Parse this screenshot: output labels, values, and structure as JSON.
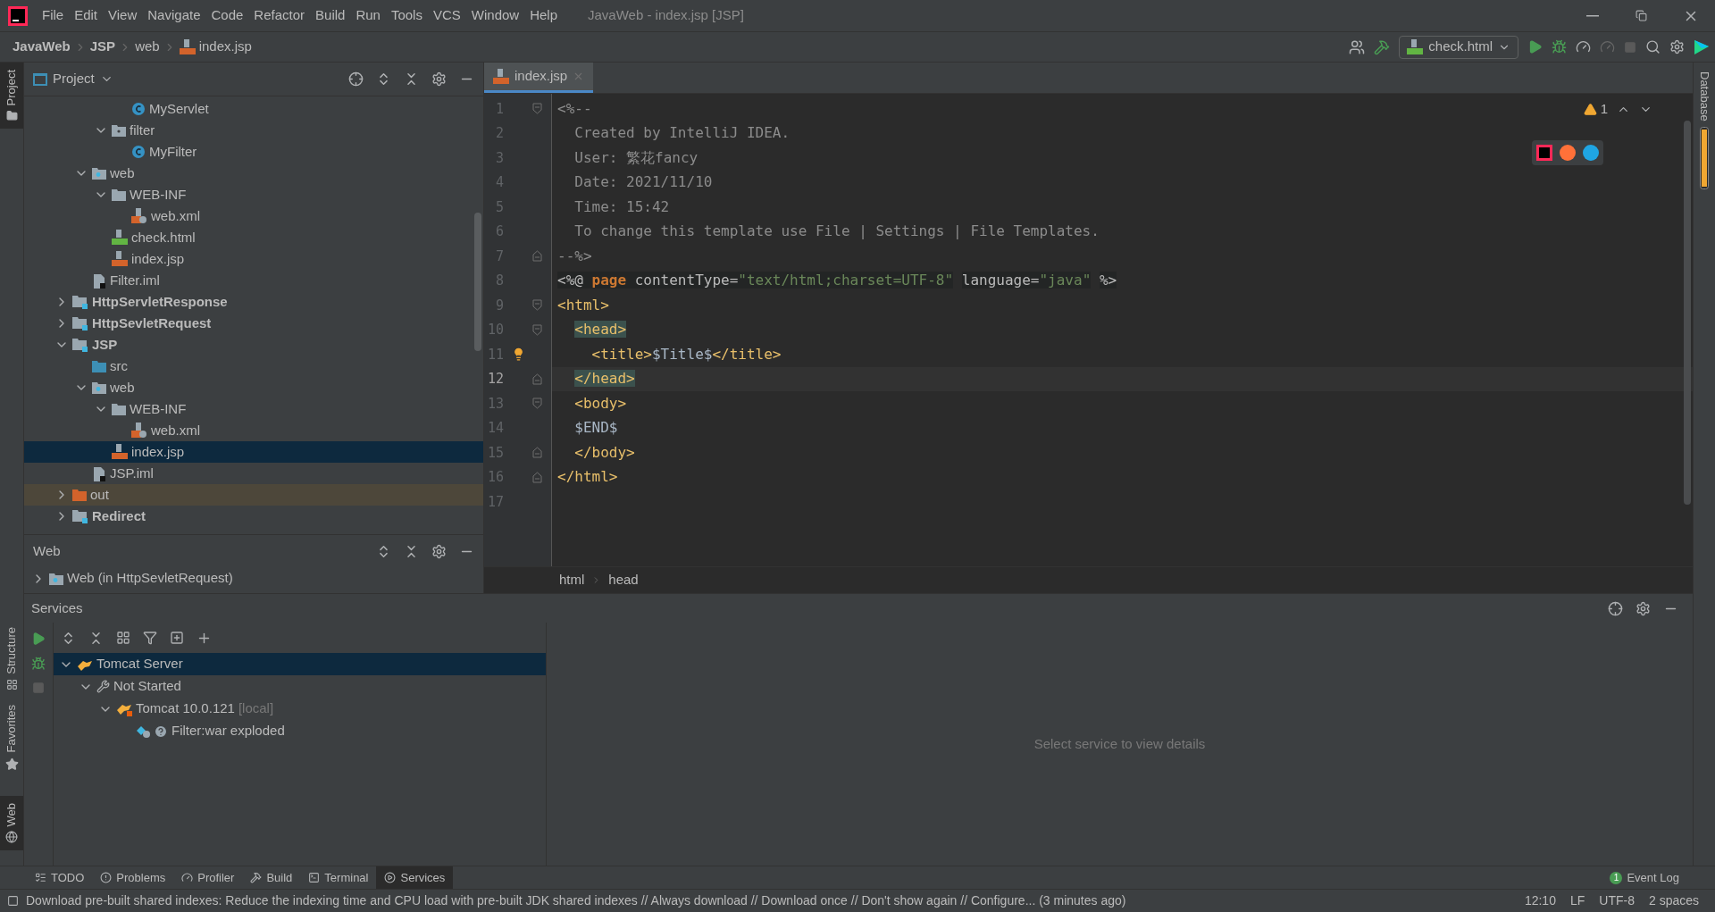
{
  "window": {
    "title": "JavaWeb - index.jsp [JSP]"
  },
  "menu": [
    "File",
    "Edit",
    "View",
    "Navigate",
    "Code",
    "Refactor",
    "Build",
    "Run",
    "Tools",
    "VCS",
    "Window",
    "Help"
  ],
  "breadcrumbs": [
    {
      "label": "JavaWeb",
      "kind": "module"
    },
    {
      "label": "JSP",
      "kind": "module"
    },
    {
      "label": "web",
      "kind": "folder"
    },
    {
      "label": "index.jsp",
      "kind": "jsp"
    }
  ],
  "run_config": "check.html",
  "left_stripe": [
    {
      "label": "Project",
      "selected": true
    },
    {
      "label": "Structure",
      "selected": false
    },
    {
      "label": "Favorites",
      "selected": false
    },
    {
      "label": "Web",
      "selected": true
    }
  ],
  "right_stripe": [
    "Database"
  ],
  "project": {
    "title": "Project",
    "tree": [
      {
        "children": [
          {
            "children": [
              {
                "children": [
                  {
                    "label": "MyServlet",
                    "kind": "class",
                    "selected": false,
                    "excluded": false
                  }
                ]
              },
              {
                "label": "filter",
                "kind": "package",
                "expanded": true,
                "selected": false,
                "excluded": false,
                "children": [
                  {
                    "label": "MyFilter",
                    "kind": "class",
                    "selected": false,
                    "excluded": false
                  }
                ]
              }
            ]
          },
          {
            "label": "web",
            "kind": "web-folder",
            "expanded": true,
            "selected": false,
            "excluded": false,
            "children": [
              {
                "label": "WEB-INF",
                "kind": "folder",
                "expanded": true,
                "selected": false,
                "excluded": false,
                "children": [
                  {
                    "label": "web.xml",
                    "kind": "xml",
                    "selected": false,
                    "excluded": false
                  }
                ]
              },
              {
                "label": "check.html",
                "kind": "html",
                "selected": false,
                "excluded": false
              },
              {
                "label": "index.jsp",
                "kind": "jsp",
                "selected": false,
                "excluded": false
              }
            ]
          },
          {
            "label": "Filter.iml",
            "kind": "iml",
            "selected": false,
            "excluded": false
          }
        ]
      },
      {
        "label": "HttpServletResponse",
        "kind": "module",
        "expanded": false,
        "selected": false,
        "excluded": false
      },
      {
        "label": "HttpSevletRequest",
        "kind": "module",
        "expanded": false,
        "selected": false,
        "excluded": false
      },
      {
        "label": "JSP",
        "kind": "module",
        "expanded": true,
        "selected": false,
        "excluded": false,
        "children": [
          {
            "label": "src",
            "kind": "source-folder",
            "selected": false,
            "excluded": false
          },
          {
            "label": "web",
            "kind": "web-folder",
            "expanded": true,
            "selected": false,
            "excluded": false,
            "children": [
              {
                "label": "WEB-INF",
                "kind": "folder",
                "expanded": true,
                "selected": false,
                "excluded": false,
                "children": [
                  {
                    "label": "web.xml",
                    "kind": "xml",
                    "selected": false,
                    "excluded": false
                  }
                ]
              },
              {
                "label": "index.jsp",
                "kind": "jsp",
                "selected": true,
                "excluded": false
              }
            ]
          },
          {
            "label": "JSP.iml",
            "kind": "iml",
            "selected": false,
            "excluded": false
          }
        ]
      },
      {
        "label": "out",
        "kind": "excluded-folder",
        "expanded": false,
        "selected": false,
        "excluded": true
      },
      {
        "label": "Redirect",
        "kind": "module",
        "expanded": false,
        "selected": false,
        "excluded": false
      }
    ]
  },
  "web_panel": {
    "title": "Web",
    "items": [
      {
        "label": "Web (in HttpSevletRequest)",
        "expanded": false
      }
    ]
  },
  "editor": {
    "tabs": [
      {
        "label": "index.jsp",
        "selected": true
      }
    ],
    "warnings": "1",
    "lines": [
      {
        "number": "1",
        "kind": "fold-start",
        "current": false,
        "bulb": false,
        "tokens": [
          {
            "t": "<%--",
            "kind": "comment"
          }
        ]
      },
      {
        "number": "2",
        "kind": "plain",
        "current": false,
        "bulb": false,
        "tokens": [
          {
            "t": "  Created by IntelliJ IDEA.",
            "kind": "comment"
          }
        ]
      },
      {
        "number": "3",
        "kind": "plain",
        "current": false,
        "bulb": false,
        "tokens": [
          {
            "t": "  User: 繁花fancy",
            "kind": "comment"
          }
        ]
      },
      {
        "number": "4",
        "kind": "plain",
        "current": false,
        "bulb": false,
        "tokens": [
          {
            "t": "  Date: 2021/11/10",
            "kind": "comment"
          }
        ]
      },
      {
        "number": "5",
        "kind": "plain",
        "current": false,
        "bulb": false,
        "tokens": [
          {
            "t": "  Time: 15:42",
            "kind": "comment"
          }
        ]
      },
      {
        "number": "6",
        "kind": "plain",
        "current": false,
        "bulb": false,
        "tokens": [
          {
            "t": "  To change this template use File | Settings | File Templates.",
            "kind": "comment"
          }
        ]
      },
      {
        "number": "7",
        "kind": "fold-end",
        "current": false,
        "bulb": false,
        "tokens": [
          {
            "t": "--%>",
            "kind": "comment"
          }
        ]
      },
      {
        "number": "8",
        "kind": "plain",
        "current": false,
        "bulb": false,
        "tokens": [
          {
            "t": "<%@ ",
            "kind": "directive"
          },
          {
            "t": "page ",
            "kind": "keyword"
          },
          {
            "t": "contentType=",
            "kind": "directive"
          },
          {
            "t": "\"text/html;charset=UTF-8\"",
            "kind": "string"
          },
          {
            "t": " language=",
            "kind": "directive"
          },
          {
            "t": "\"java\"",
            "kind": "string"
          },
          {
            "t": " %>",
            "kind": "directive"
          }
        ]
      },
      {
        "number": "9",
        "kind": "fold-start",
        "current": false,
        "bulb": false,
        "tokens": [
          {
            "t": "<html>",
            "kind": "tag"
          }
        ]
      },
      {
        "number": "10",
        "kind": "fold-start",
        "current": false,
        "bulb": false,
        "tokens": [
          {
            "t": "  <head>",
            "kind": "match"
          }
        ]
      },
      {
        "number": "11",
        "kind": "plain",
        "current": false,
        "bulb": true,
        "tokens": [
          {
            "t": "    <title>",
            "kind": "tag"
          },
          {
            "t": "$Title$",
            "kind": "text"
          },
          {
            "t": "</title>",
            "kind": "tag"
          }
        ]
      },
      {
        "number": "12",
        "kind": "fold-end",
        "current": true,
        "bulb": false,
        "tokens": [
          {
            "t": "  </head>",
            "kind": "match"
          }
        ]
      },
      {
        "number": "13",
        "kind": "fold-start",
        "current": false,
        "bulb": false,
        "tokens": [
          {
            "t": "  <body>",
            "kind": "tag"
          }
        ]
      },
      {
        "number": "14",
        "kind": "plain",
        "current": false,
        "bulb": false,
        "tokens": [
          {
            "t": "  $END$",
            "kind": "text"
          }
        ]
      },
      {
        "number": "15",
        "kind": "fold-end",
        "current": false,
        "bulb": false,
        "tokens": [
          {
            "t": "  </body>",
            "kind": "tag"
          }
        ]
      },
      {
        "number": "16",
        "kind": "fold-end",
        "current": false,
        "bulb": false,
        "tokens": [
          {
            "t": "</html>",
            "kind": "tag"
          }
        ]
      },
      {
        "number": "17",
        "kind": "plain",
        "current": false,
        "bulb": false
      }
    ],
    "path": [
      "html",
      "head"
    ]
  },
  "services": {
    "title": "Services",
    "tree": [
      {
        "label": "Tomcat Server",
        "kind": "tomcat",
        "expanded": true,
        "selected": true,
        "children": [
          {
            "label": "Not Started",
            "kind": "wrench",
            "expanded": true,
            "selected": false,
            "children": [
              {
                "label": "Tomcat 10.0.121",
                "suffix": "[local]",
                "kind": "tomcat-local",
                "expanded": true,
                "selected": false,
                "children": [
                  {
                    "label": "Filter:war exploded",
                    "kind": "artifact",
                    "selected": false
                  }
                ]
              }
            ]
          }
        ]
      }
    ],
    "empty_text": "Select service to view details"
  },
  "tool_tabs": [
    {
      "label": "TODO",
      "selected": false
    },
    {
      "label": "Problems",
      "selected": false
    },
    {
      "label": "Profiler",
      "selected": false
    },
    {
      "label": "Build",
      "selected": false
    },
    {
      "label": "Terminal",
      "selected": false
    },
    {
      "label": "Services",
      "selected": true
    }
  ],
  "event_log": {
    "label": "Event Log",
    "count": "1"
  },
  "status_bar": {
    "message": "Download pre-built shared indexes: Reduce the indexing time and CPU load with pre-built JDK shared indexes // Always download // Download once // Don't show again // Configure... (3 minutes ago)",
    "items": [
      "12:10",
      "LF",
      "UTF-8",
      "2 spaces"
    ]
  }
}
